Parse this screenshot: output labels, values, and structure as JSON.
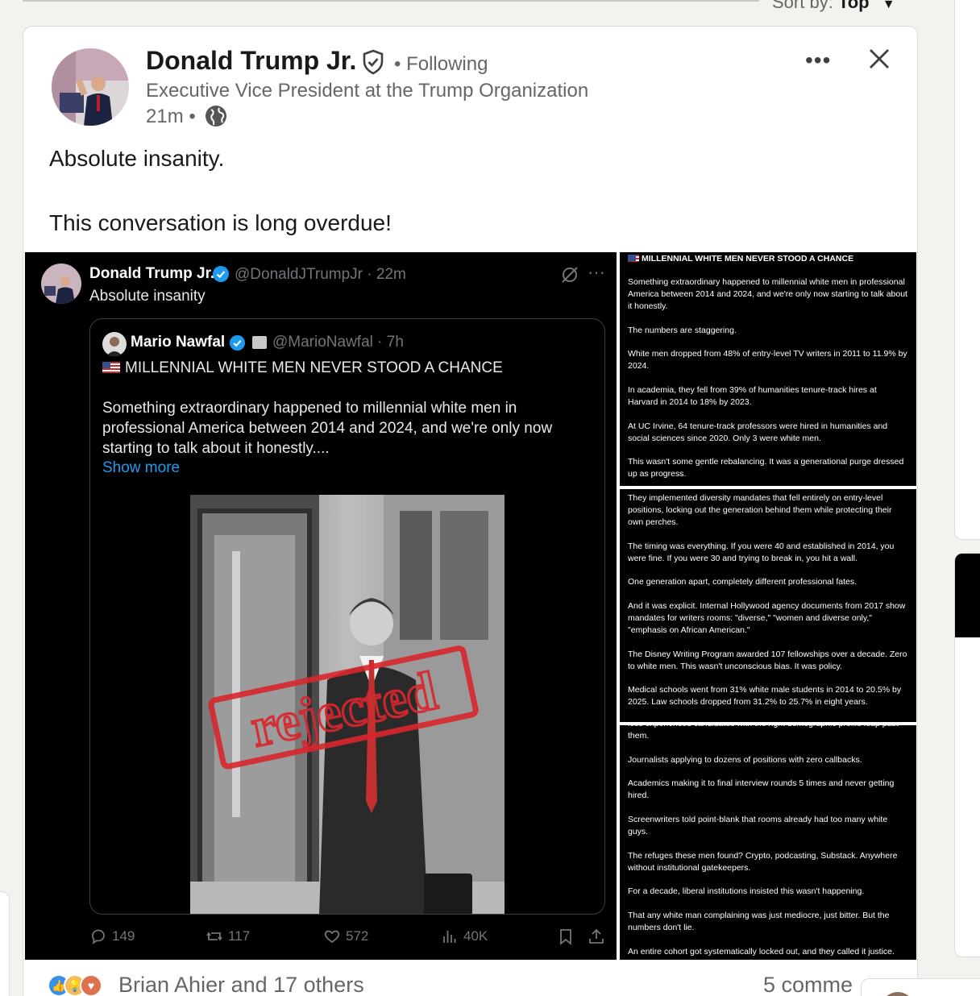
{
  "header": {
    "sort_label": "Sort by:",
    "sort_value": "Top"
  },
  "post": {
    "author": "Donald Trump Jr.",
    "follow_status": "• Following",
    "headline": "Executive Vice President at the Trump Organization",
    "time": "21m •",
    "text": [
      "Absolute insanity.",
      "This conversation is long overdue!"
    ]
  },
  "tweet": {
    "name": "Donald Trump Jr.",
    "handle": "@DonaldJTrumpJr · 22m",
    "text": "Absolute insanity",
    "quote": {
      "name": "Mario Nawfal",
      "handle": "@MarioNawfal · 7h",
      "headline": "MILLENNIAL WHITE MEN NEVER STOOD A CHANCE",
      "body": [
        "Something extraordinary happened to millennial white men in",
        "professional America between 2014 and 2024, and we're only now",
        "starting to talk about it honestly...."
      ],
      "show_more": "Show more",
      "stamp": "rejected"
    },
    "actions": {
      "replies": "149",
      "reposts": "117",
      "likes": "572",
      "views": "40K"
    }
  },
  "panels": {
    "title": "MILLENNIAL WHITE MEN NEVER STOOD A CHANCE",
    "p1": [
      "Something extraordinary happened to millennial white men in professional America between 2014 and 2024, and we're only now starting to talk about it honestly.",
      "The numbers are staggering.",
      "White men dropped from 48% of entry-level TV writers in 2011 to 11.9% by 2024.",
      "In academia, they fell from 39% of humanities tenure-track hires at Harvard in 2014 to 18% by 2023.",
      "At UC Irvine, 64 tenure-track professors were hired in humanities and social sciences since 2020. Only 3 were white men.",
      "This wasn't some gentle rebalancing. It was a generational purge dressed up as progress."
    ],
    "p2": [
      "They implemented diversity mandates that fell entirely on entry-level positions, locking out the generation behind them while protecting their own perches.",
      "The timing was everything. If you were 40 and established in 2014, you were fine. If you were 30 and trying to break in, you hit a wall.",
      "One generation apart, completely different professional fates.",
      "And it was explicit. Internal Hollywood agency documents from 2017 show mandates for writers rooms: \"diverse,\" \"women and diverse only,\" \"emphasis on African American.\"",
      "The Disney Writing Program awarded 107 fellowships over a decade. Zero to white men. This wasn't unconscious bias. It was policy.",
      "Medical schools went from 31% white male students in 2014 to 20.5% by 2025. Law schools dropped from 31.2% to 25.7% in eight years."
    ],
    "p3": [
      "less experienced candidates with the right demographic profile leap past them.",
      "Journalists applying to dozens of positions with zero callbacks.",
      "Academics making it to final interview rounds 5 times and never getting hired.",
      "Screenwriters told point-blank that rooms already had too many white guys.",
      "The refuges these men found? Crypto, podcasting, Substack. Anywhere without institutional gatekeepers.",
      "For a decade, liberal institutions insisted this wasn't happening.",
      "That any white man complaining was just mediocre, just bitter. But the numbers don't lie.",
      "An entire cohort got systematically locked out, and they called it justice."
    ]
  },
  "social": {
    "reactions_text": "Brian Ahier and 17 others",
    "comments_text": "5 comme"
  },
  "colors": {
    "link_blue": "#1d9bf0",
    "linkedin_text": "#191919",
    "muted": "#666666"
  }
}
